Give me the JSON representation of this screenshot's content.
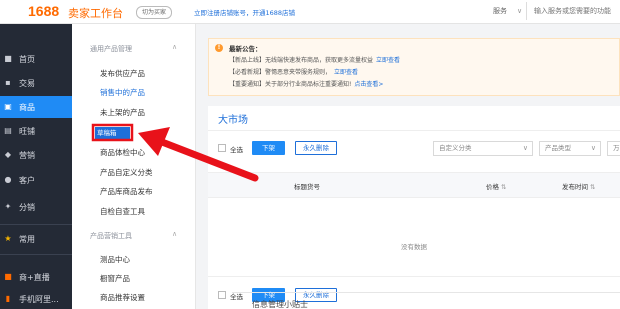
{
  "header": {
    "logo": "1688",
    "title": "卖家工作台",
    "switch_label": "切为买家",
    "register_link": "立即注册店铺账号，开通1688店铺",
    "service_select": "服务",
    "search_placeholder": "输入服务或您需要的功能"
  },
  "sidebar": {
    "items": [
      {
        "label": "首页",
        "icon": "home-icon"
      },
      {
        "label": "交易",
        "icon": "trade-icon"
      },
      {
        "label": "商品",
        "icon": "goods-icon"
      },
      {
        "label": "旺铺",
        "icon": "shop-icon"
      },
      {
        "label": "营销",
        "icon": "marketing-icon"
      },
      {
        "label": "客户",
        "icon": "customer-icon"
      },
      {
        "label": "分销",
        "icon": "distribution-icon"
      },
      {
        "label": "常用",
        "icon": "star-icon"
      },
      {
        "label": "商+直播",
        "icon": "live-icon"
      },
      {
        "label": "手机阿里...",
        "icon": "phone-icon"
      }
    ]
  },
  "submenu": {
    "group1": "通用产品管理",
    "group1_items": [
      "发布供应产品",
      "销售中的产品",
      "未上架的产品",
      "草稿箱",
      "商品体检中心",
      "产品自定义分类",
      "产品库商品发布",
      "自检自查工具"
    ],
    "group2": "产品营销工具",
    "group2_items": [
      "测品中心",
      "橱窗产品",
      "商品推荐设置"
    ]
  },
  "notice": {
    "title": "最新公告：",
    "lines": [
      {
        "text": "【新品上线】无线端快速发布商品，获取更多流量权益",
        "link": "立即查看"
      },
      {
        "text": "【必看新规】警惕恶意夹带服务规则，",
        "link": "立即查看"
      },
      {
        "text": "【重要通知】关于部分行业商品标注重要通知!",
        "link": "点击查看>"
      }
    ]
  },
  "market": {
    "title": "大市场",
    "select_all": "全选",
    "delist_button": "下架",
    "delete_button": "永久删除",
    "custom_category": "自定义分类",
    "product_type": "产品类型",
    "extra_select": "万",
    "col_title": "标题货号",
    "col_price": "价格",
    "col_time": "发布时间",
    "sort_icon": "⇅",
    "empty": "没有数据",
    "tips_title": "信息管理小贴士"
  },
  "colors": {
    "accent": "#1f8bf5",
    "sidebar_bg": "#242a36",
    "brand": "#ff6a00",
    "annotation_red": "#e8121a"
  }
}
